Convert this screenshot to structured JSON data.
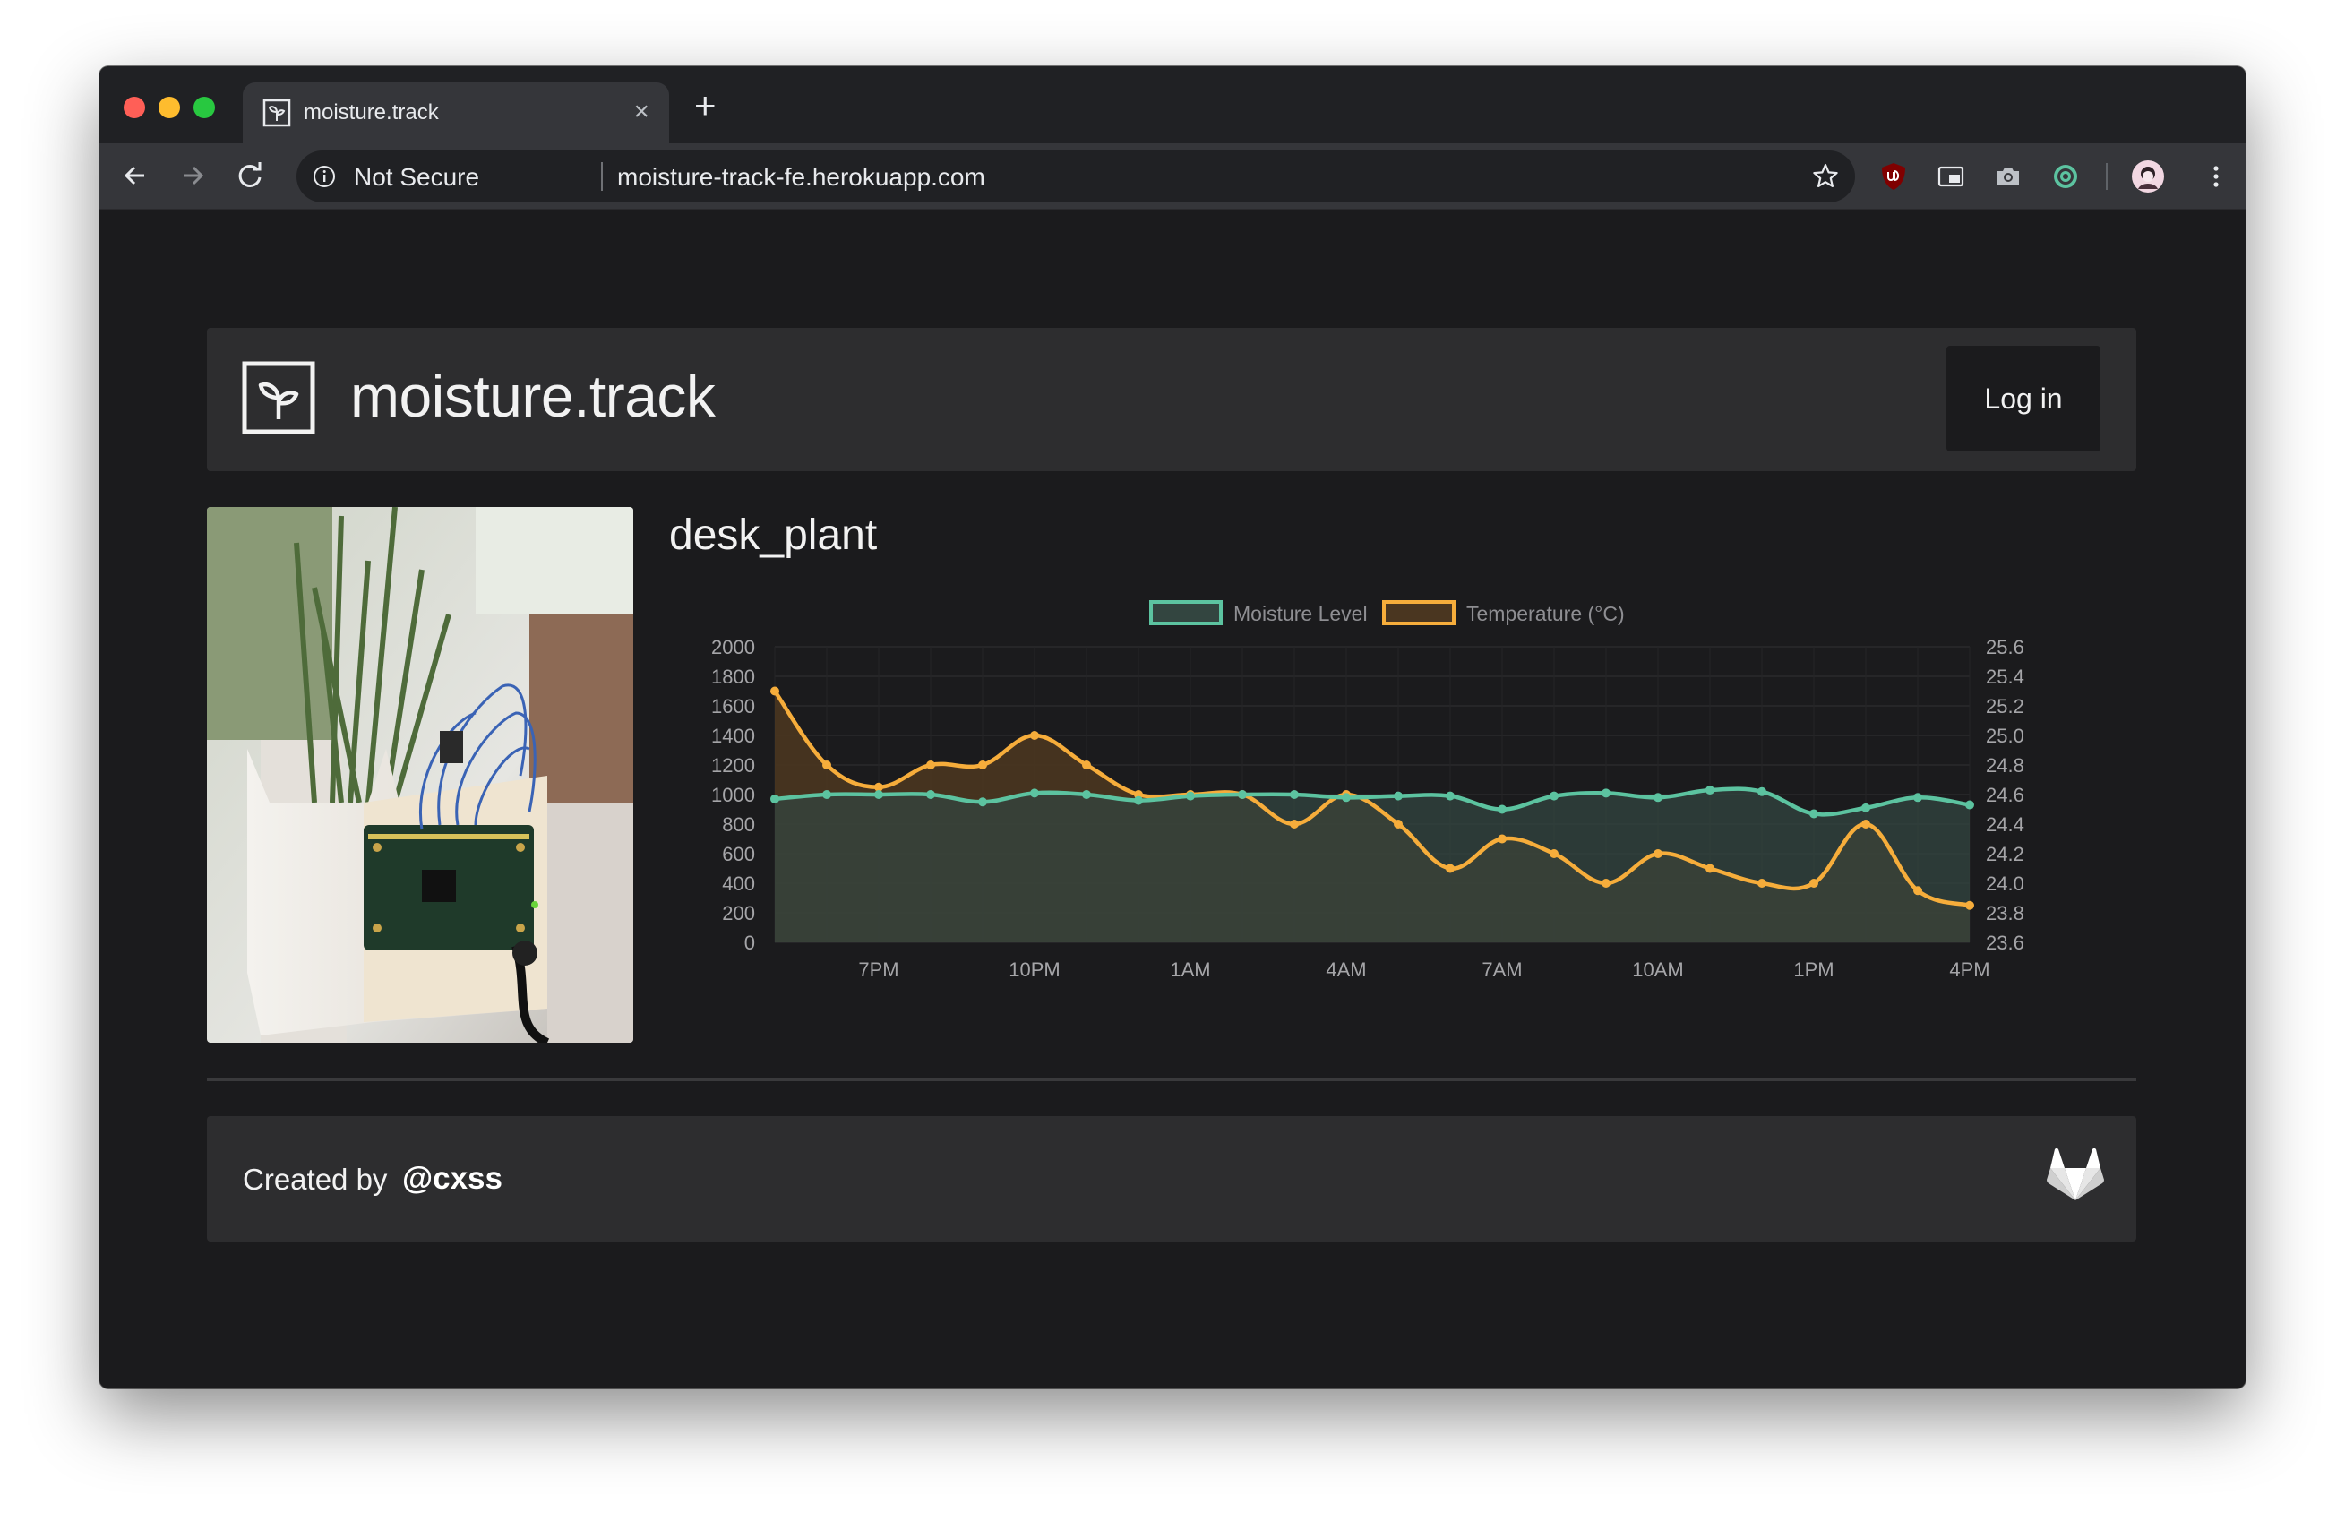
{
  "browser": {
    "tab_title": "moisture.track",
    "tab_close": "×",
    "new_tab": "+",
    "security_label": "Not Secure",
    "url": "moisture-track-fe.herokuapp.com"
  },
  "header": {
    "brand": "moisture.track",
    "login_label": "Log in"
  },
  "plant": {
    "name": "desk_plant"
  },
  "footer": {
    "created_by": "Created by",
    "handle": "@cxss"
  },
  "colors": {
    "moisture": "#5cc3a0",
    "temperature": "#f6ad3b",
    "moisture_fill": "#334540",
    "temperature_fill": "#4a3620"
  },
  "chart_data": {
    "type": "line",
    "x": [
      "5PM",
      "6PM",
      "7PM",
      "8PM",
      "9PM",
      "10PM",
      "11PM",
      "12AM",
      "1AM",
      "2AM",
      "3AM",
      "4AM",
      "5AM",
      "6AM",
      "7AM",
      "8AM",
      "9AM",
      "10AM",
      "11AM",
      "12PM",
      "1PM",
      "2PM",
      "3PM",
      "4PM"
    ],
    "xticks": [
      "7PM",
      "10PM",
      "1AM",
      "4AM",
      "7AM",
      "10AM",
      "1PM",
      "4PM"
    ],
    "legend": [
      "Moisture Level",
      "Temperature (°C)"
    ],
    "legend_position": "top",
    "series": [
      {
        "name": "Moisture Level",
        "axis": "left",
        "values": [
          970,
          1000,
          1000,
          1000,
          950,
          1010,
          1000,
          960,
          990,
          1000,
          1000,
          980,
          990,
          990,
          900,
          990,
          1010,
          980,
          1030,
          1020,
          870,
          910,
          980,
          930
        ]
      },
      {
        "name": "Temperature (°C)",
        "axis": "right",
        "values": [
          25.3,
          24.8,
          24.65,
          24.8,
          24.8,
          25.0,
          24.8,
          24.6,
          24.6,
          24.6,
          24.4,
          24.6,
          24.4,
          24.1,
          24.3,
          24.2,
          24.0,
          24.2,
          24.1,
          24.0,
          24.0,
          24.4,
          23.95,
          23.85
        ]
      }
    ],
    "y_left": {
      "ticks": [
        "0",
        "200",
        "400",
        "600",
        "800",
        "1000",
        "1200",
        "1400",
        "1600",
        "1800",
        "2000"
      ],
      "range": [
        0,
        2000
      ]
    },
    "y_right": {
      "ticks": [
        "23.6",
        "23.8",
        "24.0",
        "24.2",
        "24.4",
        "24.6",
        "24.8",
        "25.0",
        "25.2",
        "25.4",
        "25.6"
      ],
      "range": [
        23.6,
        25.6
      ]
    },
    "grid": true
  }
}
